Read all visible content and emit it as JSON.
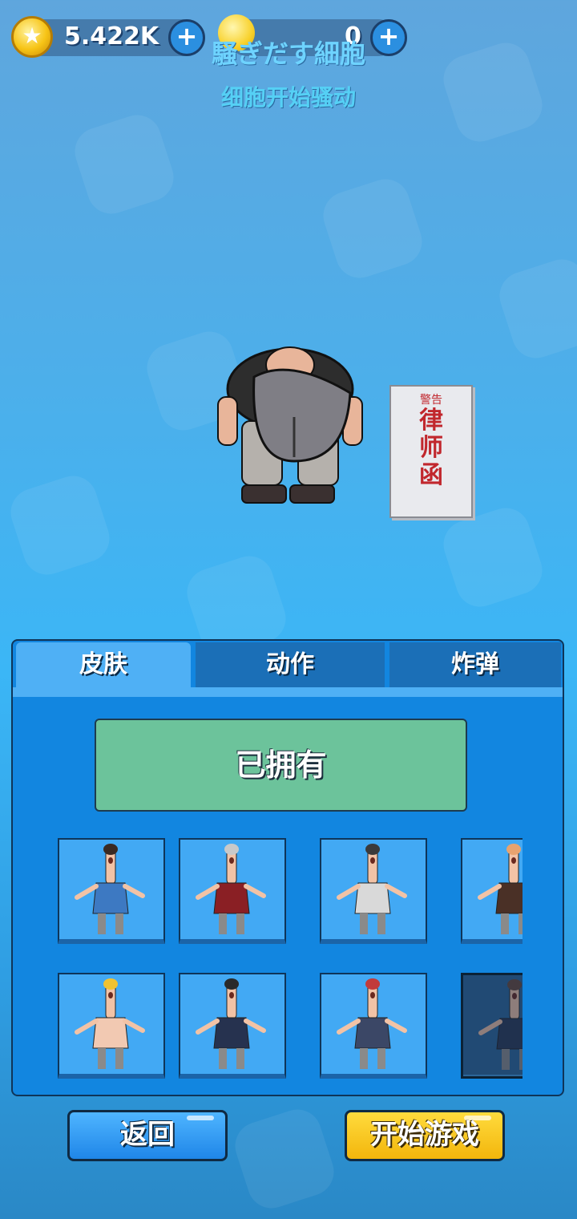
{
  "hud": {
    "coins": "5.422K",
    "gems": "0",
    "coin_plus": "+",
    "gem_plus": "+"
  },
  "header": {
    "title_jp": "騒ぎだす細胞",
    "title_cn": "细胞开始骚动"
  },
  "stage": {
    "card_lines": [
      "警告",
      "律",
      "师",
      "函"
    ]
  },
  "tabs": [
    {
      "label": "皮肤",
      "active": true
    },
    {
      "label": "动作",
      "active": false
    },
    {
      "label": "炸弹",
      "active": false
    }
  ],
  "owned_label": "已拥有",
  "skins": [
    {
      "name": "skin-blue-outfit",
      "shirt": "#3d79c2",
      "hair": "#3a2a22",
      "locked": false
    },
    {
      "name": "skin-chef-apron",
      "shirt": "#8a1f24",
      "hair": "#c9c9c9",
      "locked": false
    },
    {
      "name": "skin-helmet-soldier",
      "shirt": "#d9d9d9",
      "hair": "#3b3b3b",
      "locked": false
    },
    {
      "name": "skin-brown-shirt",
      "shirt": "#4a3026",
      "hair": "#e8a36f",
      "locked": false
    },
    {
      "name": "skin-blonde-pose",
      "shirt": "#f2c9b2",
      "hair": "#f1c232",
      "locked": false
    },
    {
      "name": "skin-suit",
      "shirt": "#26324f",
      "hair": "#2a2a2a",
      "locked": false
    },
    {
      "name": "skin-beanie-dance",
      "shirt": "#3b4766",
      "hair": "#c23b3b",
      "locked": false
    },
    {
      "name": "skin-horse-mask",
      "shirt": "#2b3a55",
      "hair": "#6b4a3a",
      "locked": true
    }
  ],
  "buttons": {
    "back": "返回",
    "start": "开始游戏"
  },
  "colors": {
    "accent_blue": "#1286e0",
    "owned_green": "#6cc39b",
    "start_yellow": "#f3b60c"
  }
}
